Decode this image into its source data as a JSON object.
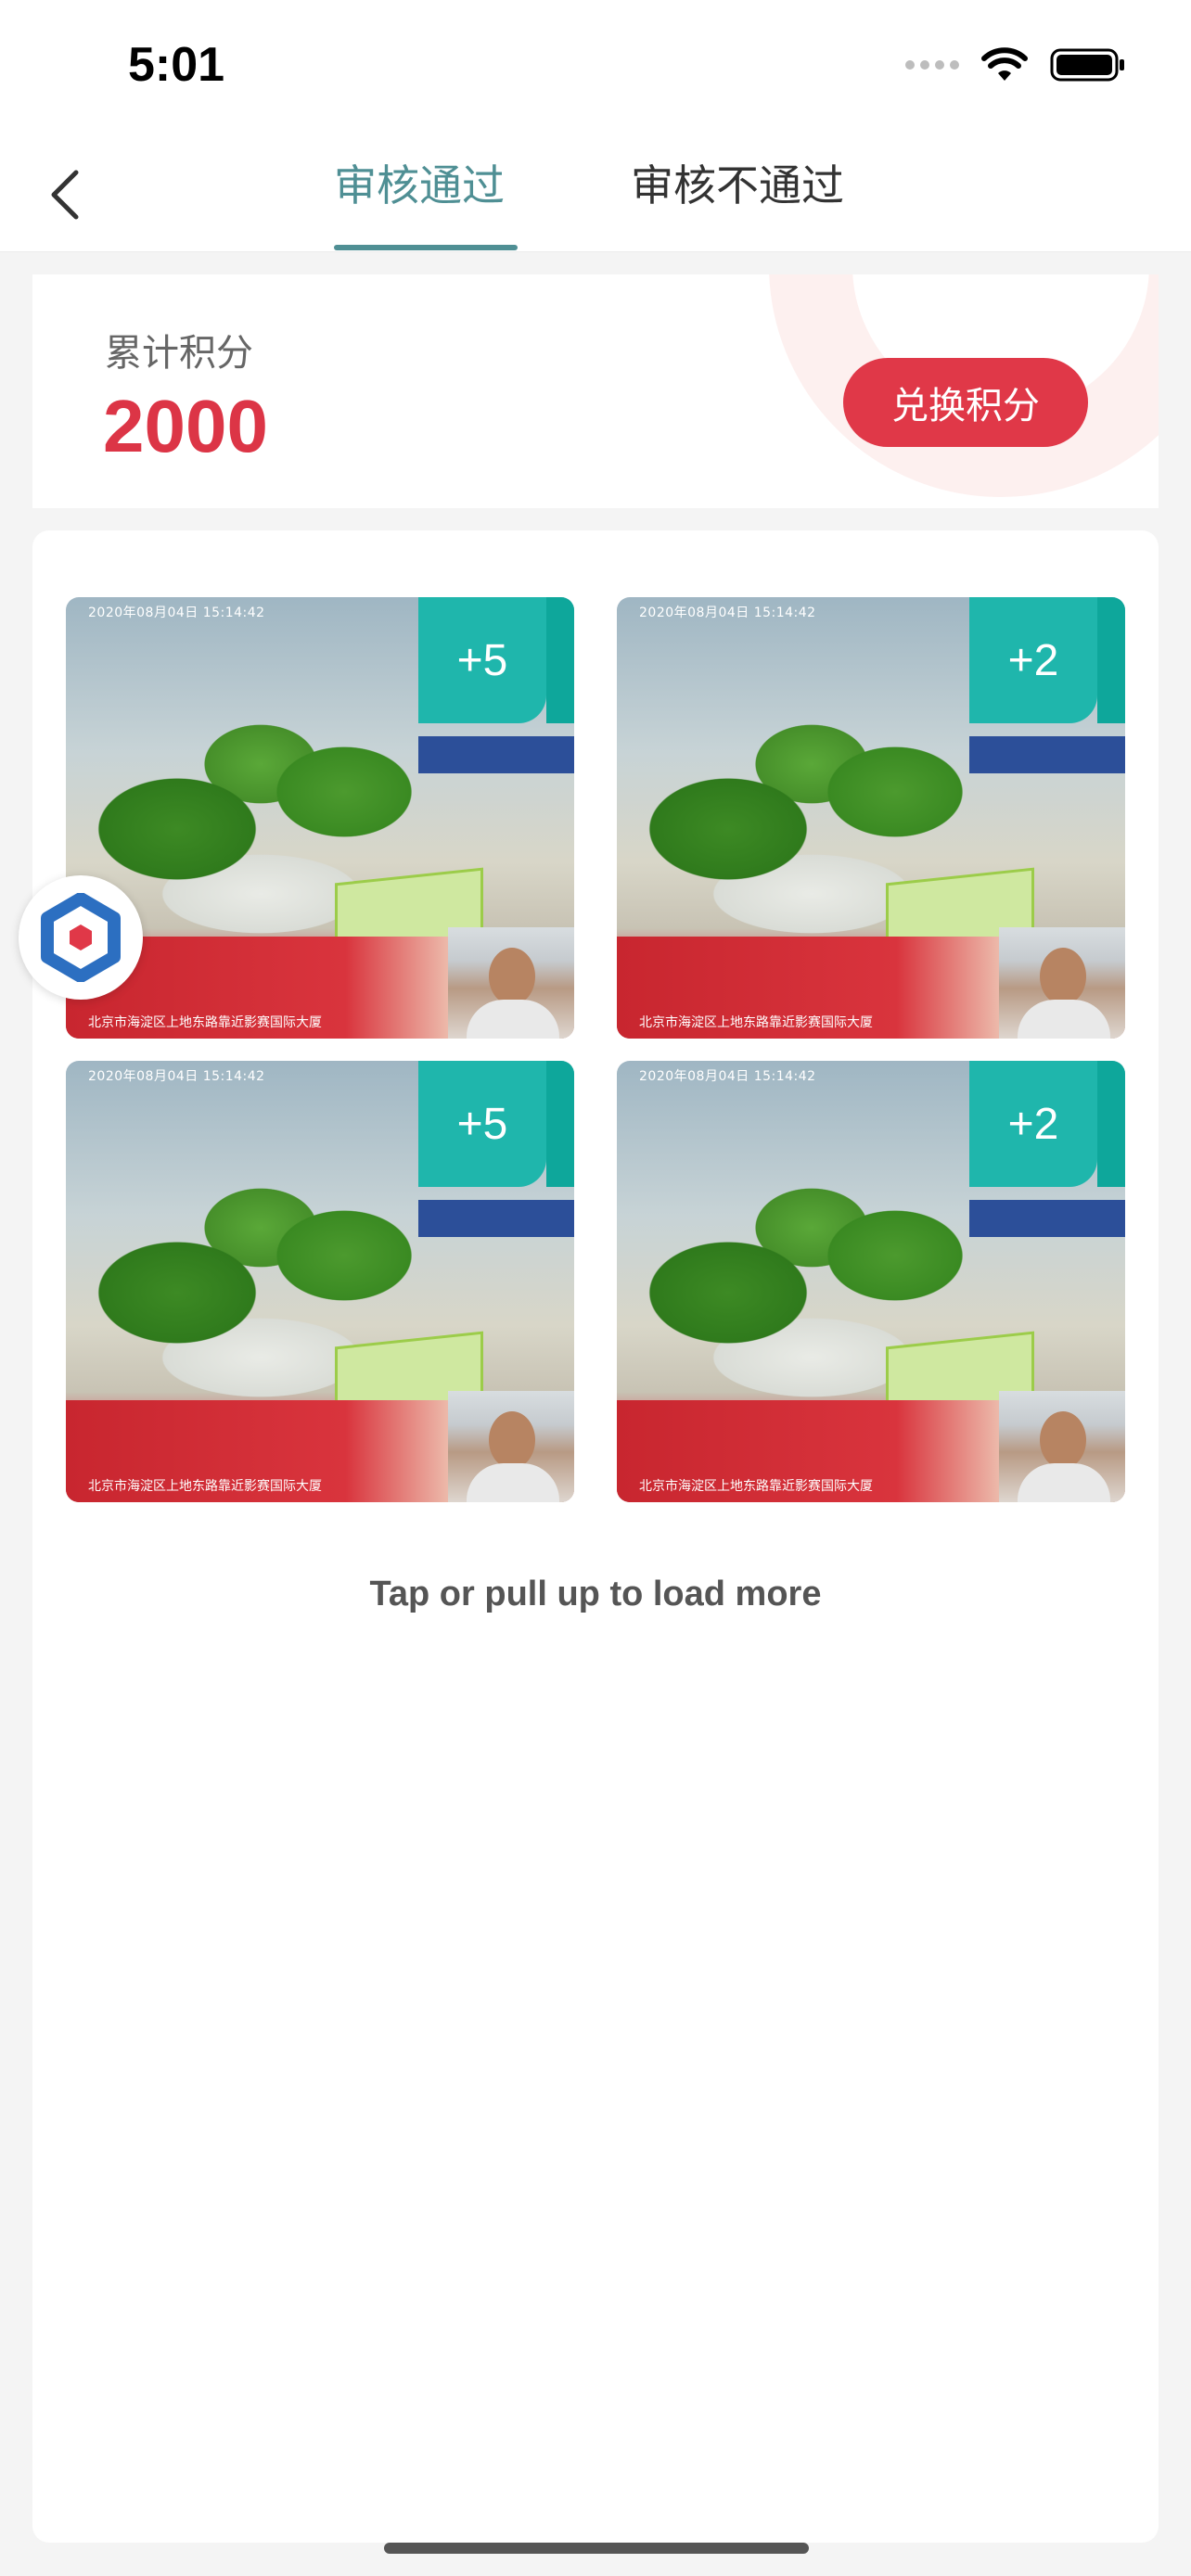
{
  "status_bar": {
    "time": "5:01"
  },
  "nav": {
    "back_icon": "chevron-left-icon",
    "tabs": [
      {
        "label": "审核通过",
        "active": true
      },
      {
        "label": "审核不通过",
        "active": false
      }
    ],
    "accent_color": "#4f8f94"
  },
  "points": {
    "label": "累计积分",
    "value": "2000",
    "exchange_label": "兑换积分",
    "value_color": "#dc3546"
  },
  "photos": [
    {
      "timestamp": "2020年08月04日 15:14:42",
      "address": "北京市海淀区上地东路靠近影赛国际大厦",
      "score": "+5"
    },
    {
      "timestamp": "2020年08月04日 15:14:42",
      "address": "北京市海淀区上地东路靠近影赛国际大厦",
      "score": "+2"
    },
    {
      "timestamp": "2020年08月04日 15:14:42",
      "address": "北京市海淀区上地东路靠近影赛国际大厦",
      "score": "+5"
    },
    {
      "timestamp": "2020年08月04日 15:14:42",
      "address": "北京市海淀区上地东路靠近影赛国际大厦",
      "score": "+2"
    }
  ],
  "load_more": "Tap or pull up to load more",
  "badge_color": "#1fb6ac"
}
